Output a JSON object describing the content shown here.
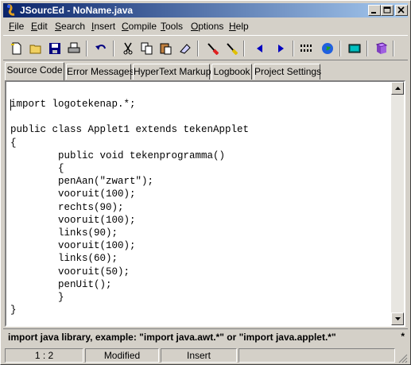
{
  "window": {
    "title": "JSourcEd - NoName.java"
  },
  "menu": [
    {
      "label": "File",
      "accel": "F",
      "rest": "ile"
    },
    {
      "label": "Edit",
      "accel": "E",
      "rest": "dit"
    },
    {
      "label": "Search",
      "accel": "S",
      "rest": "earch"
    },
    {
      "label": "Insert",
      "accel": "I",
      "rest": "nsert"
    },
    {
      "label": "Compile",
      "accel": "C",
      "rest": "ompile"
    },
    {
      "label": "Tools",
      "accel": "T",
      "rest": "ools"
    },
    {
      "label": "Options",
      "accel": "O",
      "rest": "ptions"
    },
    {
      "label": "Help",
      "accel": "H",
      "rest": "elp"
    }
  ],
  "toolbar": [
    "new-file-icon",
    "open-folder-icon",
    "save-icon",
    "print-icon",
    "undo-icon",
    "cut-icon",
    "copy-icon",
    "paste-icon",
    "eraser-icon",
    "brush-icon",
    "clear-icon",
    "arrow-left-icon",
    "arrow-right-icon",
    "binary-icon",
    "globe-icon",
    "calculator-icon",
    "book-icon"
  ],
  "tabs": [
    "Source Code",
    "Error Messages",
    "HyperText Markup",
    "Logbook",
    "Project Settings"
  ],
  "active_tab": "Source Code",
  "code": "import logotekenap.*;\n\npublic class Applet1 extends tekenApplet\n{\n\tpublic void tekenprogramma()\n\t{\n\tpenAan(\"zwart\");\n\tvooruit(100);\n\trechts(90);\n\tvooruit(100);\n\tlinks(90);\n\tvooruit(100);\n\tlinks(60);\n\tvooruit(50);\n\tpenUit();\n\t}\n}",
  "hint": {
    "text": "import java library, example: \"import java.awt.*\" or \"import java.applet.*\"",
    "marker": "*"
  },
  "status": {
    "position": "1 : 2",
    "modified": "Modified",
    "mode": "Insert"
  },
  "colors": {
    "title_start": "#0a246a",
    "title_end": "#a6caf0",
    "face": "#d4d0c8"
  }
}
